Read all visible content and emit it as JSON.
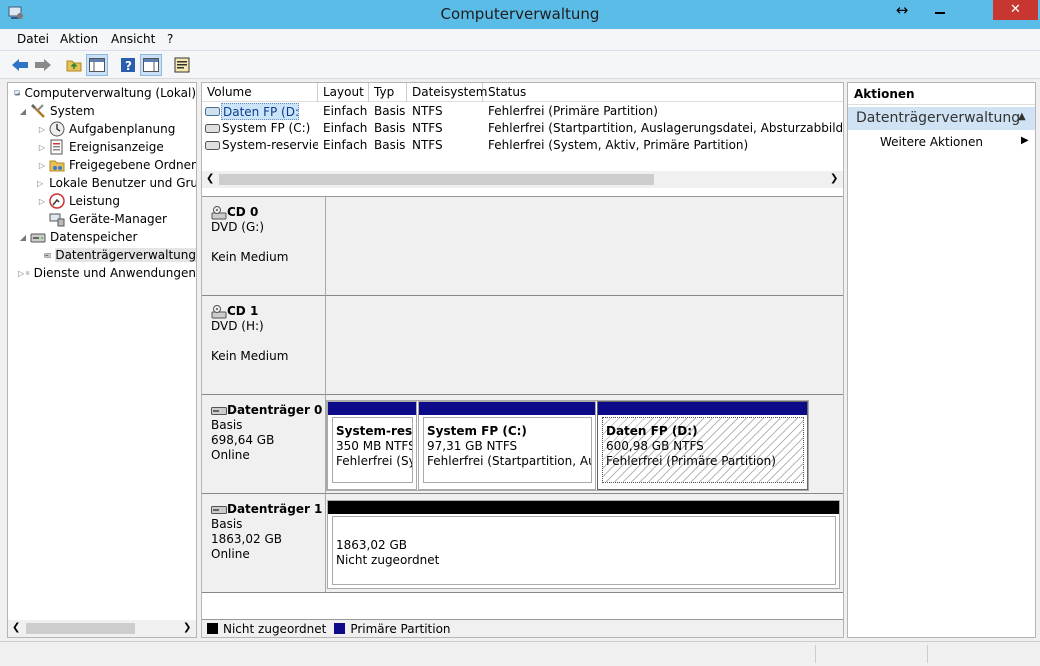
{
  "window": {
    "title": "Computerverwaltung",
    "close_label": "✕",
    "min_label": "▬",
    "resize_label": "↔"
  },
  "menu": {
    "items": [
      "Datei",
      "Aktion",
      "Ansicht",
      "?"
    ]
  },
  "tree": {
    "items": [
      {
        "label": "Computerverwaltung (Lokal)",
        "icon": "computer-management-icon"
      },
      {
        "label": "System",
        "icon": "tools-icon"
      },
      {
        "label": "Aufgabenplanung",
        "icon": "clock-icon"
      },
      {
        "label": "Ereignisanzeige",
        "icon": "event-viewer-icon"
      },
      {
        "label": "Freigegebene Ordner",
        "icon": "shared-folder-icon"
      },
      {
        "label": "Lokale Benutzer und Gruppen",
        "icon": "users-icon"
      },
      {
        "label": "Leistung",
        "icon": "performance-icon"
      },
      {
        "label": "Geräte-Manager",
        "icon": "device-manager-icon"
      },
      {
        "label": "Datenspeicher",
        "icon": "storage-icon"
      },
      {
        "label": "Datenträgerverwaltung",
        "icon": "disk-management-icon"
      },
      {
        "label": "Dienste und Anwendungen",
        "icon": "services-icon"
      }
    ]
  },
  "volumes": {
    "columns": [
      "Volume",
      "Layout",
      "Typ",
      "Dateisystem",
      "Status"
    ],
    "rows": [
      [
        "Daten FP (D:)",
        "Einfach",
        "Basis",
        "NTFS",
        "Fehlerfrei (Primäre Partition)"
      ],
      [
        "System FP (C:)",
        "Einfach",
        "Basis",
        "NTFS",
        "Fehlerfrei (Startpartition, Auslagerungsdatei, Absturzabbild, Primäre Partition)"
      ],
      [
        "System-reserviert",
        "Einfach",
        "Basis",
        "NTFS",
        "Fehlerfrei (System, Aktiv, Primäre Partition)"
      ]
    ]
  },
  "disks": {
    "cd0": {
      "name": "CD 0",
      "lines": [
        "DVD (G:)",
        "",
        "Kein Medium"
      ]
    },
    "cd1": {
      "name": "CD 1",
      "lines": [
        "DVD (H:)",
        "",
        "Kein Medium"
      ]
    },
    "disk0": {
      "name": "Datenträger 0",
      "lines": [
        "Basis",
        "698,64 GB",
        "Online"
      ],
      "partitions": [
        {
          "name": "System-reserviert",
          "size": "350 MB NTFS",
          "status": "Fehlerfrei (System, Aktiv, Primäre Partition)"
        },
        {
          "name": "System FP  (C:)",
          "size": "97,31 GB NTFS",
          "status": "Fehlerfrei (Startpartition, Auslagerungsdatei, Absturzabbild, Primäre Partition)"
        },
        {
          "name": "Daten FP  (D:)",
          "size": "600,98 GB NTFS",
          "status": "Fehlerfrei (Primäre Partition)"
        }
      ]
    },
    "disk1": {
      "name": "Datenträger 1",
      "lines": [
        "Basis",
        "1863,02 GB",
        "Online"
      ],
      "unallocated": {
        "size": "1863,02 GB",
        "status": "Nicht zugeordnet"
      }
    }
  },
  "legend": {
    "items": [
      {
        "label": "Nicht zugeordnet",
        "color": "#000000"
      },
      {
        "label": "Primäre Partition",
        "color": "#0b0b8a"
      }
    ]
  },
  "actions": {
    "header": "Aktionen",
    "section": "Datenträgerverwaltung",
    "more": "Weitere Aktionen"
  }
}
